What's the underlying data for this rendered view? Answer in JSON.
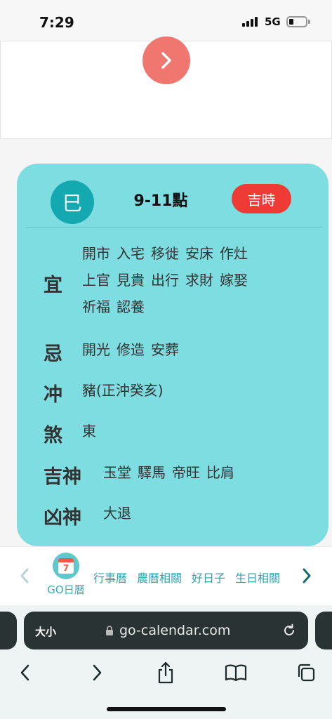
{
  "status": {
    "time": "7:29",
    "network": "5G"
  },
  "card": {
    "branch": "巳",
    "hours": "9-11點",
    "luck_badge": "吉時",
    "rows": [
      {
        "label": "宜",
        "items": [
          [
            "開市",
            "入宅",
            "移徙",
            "安床",
            "作灶"
          ],
          [
            "上官",
            "見貴",
            "出行",
            "求財",
            "嫁娶"
          ],
          [
            "祈福",
            "認養"
          ]
        ]
      },
      {
        "label": "忌",
        "items": [
          [
            "開光",
            "修造",
            "安葬"
          ]
        ]
      },
      {
        "label": "冲",
        "items": [
          [
            "豬(正沖癸亥)"
          ]
        ]
      },
      {
        "label": "煞",
        "items": [
          [
            "東"
          ]
        ]
      },
      {
        "label": "吉神",
        "items": [
          [
            "玉堂",
            "驛馬",
            "帝旺",
            "比肩"
          ]
        ]
      },
      {
        "label": "凶神",
        "items": [
          [
            "大退"
          ]
        ]
      }
    ]
  },
  "nav": {
    "calendar_day": "7",
    "app_label": "GO日曆",
    "links": [
      "行事曆",
      "農曆相關",
      "好日子",
      "生日相關"
    ]
  },
  "browser": {
    "text_size_label": "大小",
    "url": "go-calendar.com"
  },
  "colors": {
    "card": "#7ddde0",
    "accent": "#14a8b0",
    "badge": "#ef3b36",
    "arrow_button": "#f0776f"
  }
}
